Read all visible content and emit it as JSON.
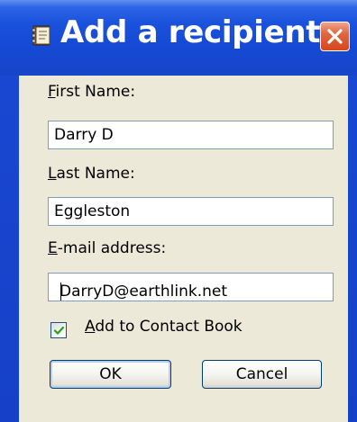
{
  "dialog": {
    "title": "Add a recipient",
    "title_icon": "address-book-icon",
    "close_icon": "close-icon",
    "close_color": "#d5471d",
    "titlebar_color": "#1548d3"
  },
  "form": {
    "first_name": {
      "label_accel": "F",
      "label_rest": "irst Name:",
      "value": "Darry D"
    },
    "last_name": {
      "label_accel": "L",
      "label_rest": "ast Name:",
      "value": "Eggleston"
    },
    "email": {
      "label_accel": "E",
      "label_rest": "-mail address:",
      "value": "DarryD@earthlink.net"
    },
    "add_to_contacts": {
      "label_accel": "A",
      "label_rest": "dd to Contact Book",
      "checked": true
    }
  },
  "buttons": {
    "ok_label": "OK",
    "cancel_label": "Cancel"
  }
}
